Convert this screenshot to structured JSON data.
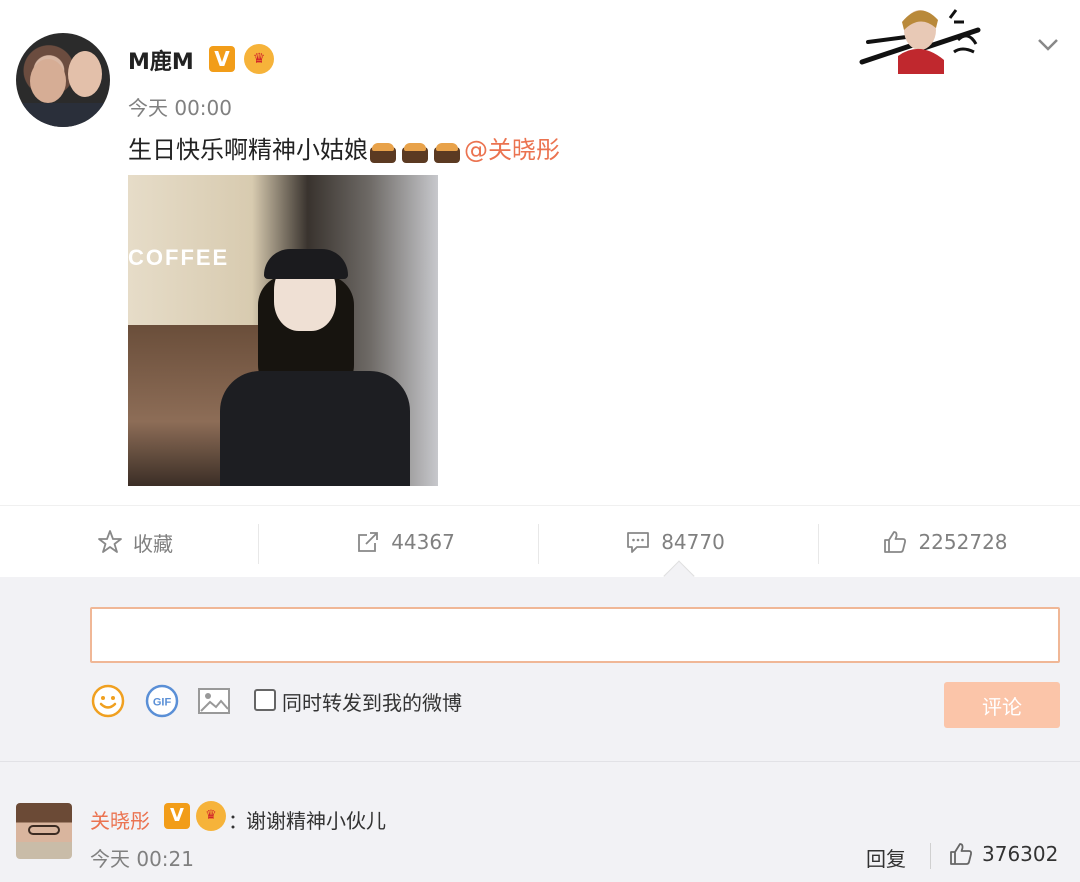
{
  "post": {
    "username": "M鹿M",
    "verified_badge": "V",
    "crown_badge": "👑",
    "time": "今天 00:00",
    "text": "生日快乐啊精神小姑娘",
    "mention": "@关晓彤",
    "photo_sign": "COFFEE"
  },
  "actions": {
    "favorite_label": "收藏",
    "repost_count": "44367",
    "comment_count": "84770",
    "like_count": "2252728"
  },
  "comment_box": {
    "input_value": "",
    "repost_label": "同时转发到我的微博",
    "submit_label": "评论",
    "gif_label": "GIF"
  },
  "reply": {
    "username": "关晓彤",
    "verified_badge": "V",
    "crown_badge": "👑",
    "colon": "：",
    "text": "谢谢精神小伙儿",
    "time": "今天 00:21",
    "reply_label": "回复",
    "like_count": "376302"
  },
  "colors": {
    "accent": "#eb7350",
    "badge_orange": "#f29d19",
    "panel_bg": "#f2f2f5",
    "submit_disabled": "#fbc5a9"
  },
  "icons": [
    "star-icon",
    "repost-icon",
    "comment-icon",
    "thumb-up-icon",
    "smiley-icon",
    "gif-icon",
    "image-icon",
    "chevron-down-icon"
  ]
}
